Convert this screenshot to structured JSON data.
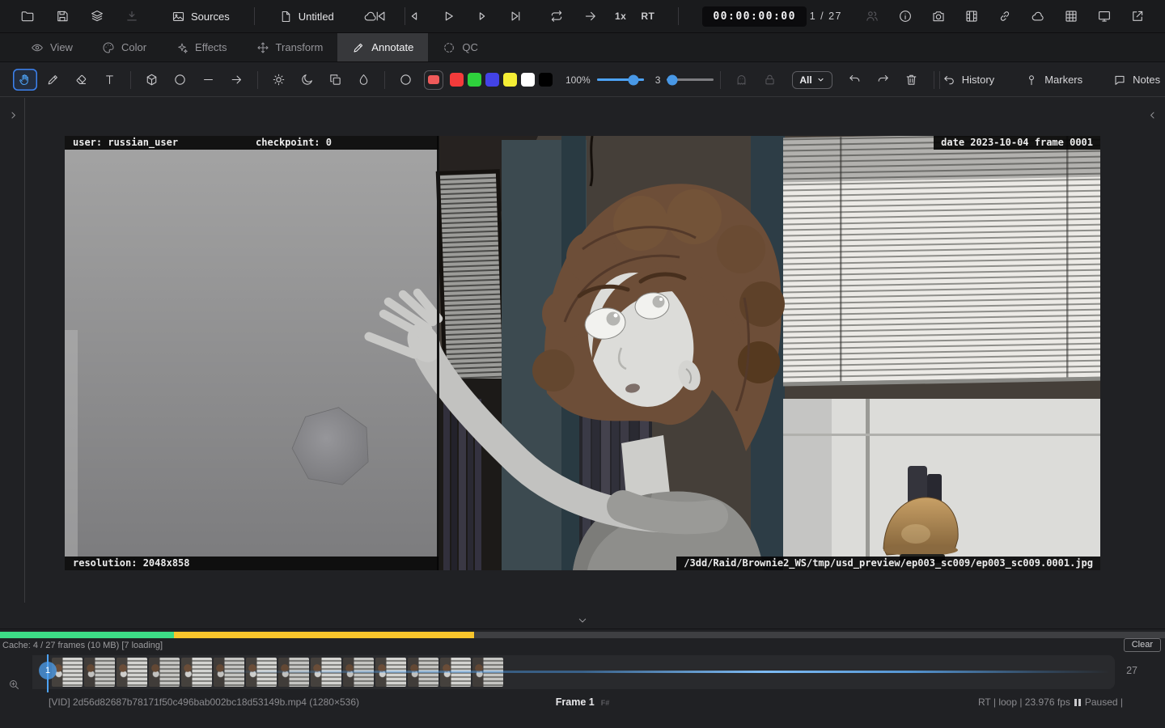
{
  "topbar": {
    "file_icons": [
      {
        "icon": "folder"
      },
      {
        "icon": "save"
      },
      {
        "icon": "layers"
      },
      {
        "icon": "download",
        "dim": true
      }
    ],
    "sources_icon": "image",
    "sources_label": "Sources",
    "untitled_icon": "file",
    "untitled_label": "Untitled",
    "cloud_icon": "cloud",
    "transport_icons": [
      {
        "icon": "skip-start"
      },
      {
        "icon": "step-back"
      },
      {
        "icon": "play"
      },
      {
        "icon": "step-forward"
      },
      {
        "icon": "skip-end"
      }
    ],
    "loop_icon": "repeat",
    "goto_icon": "arrow-right",
    "speed_label": "1x",
    "rt_label": "RT",
    "timecode": "00:00:00:00",
    "frame_counter": "1 / 27",
    "right_icons": [
      {
        "icon": "people",
        "dim": true
      },
      {
        "icon": "info"
      },
      {
        "icon": "camera"
      },
      {
        "icon": "film"
      },
      {
        "icon": "link"
      },
      {
        "icon": "cloud"
      },
      {
        "icon": "grid"
      },
      {
        "icon": "monitor"
      },
      {
        "icon": "external"
      }
    ]
  },
  "tabs": [
    {
      "label": "View",
      "icon": "eye",
      "active": false
    },
    {
      "label": "Color",
      "icon": "palette",
      "active": false
    },
    {
      "label": "Effects",
      "icon": "sparkles",
      "active": false
    },
    {
      "label": "Transform",
      "icon": "move",
      "active": false
    },
    {
      "label": "Annotate",
      "icon": "pencil",
      "active": true
    },
    {
      "label": "QC",
      "icon": "qc",
      "active": false
    }
  ],
  "annotate": {
    "tools": [
      "hand",
      "pencil",
      "eraser",
      "text",
      "|",
      "cube",
      "circle",
      "line",
      "arrow-right",
      "|",
      "sun",
      "moon",
      "copy",
      "droplet",
      "|",
      "color-ring"
    ],
    "selected_tool": "hand",
    "current_color": "#f05a5a",
    "palette": [
      "#f43b3b",
      "#2ed13c",
      "#4343e6",
      "#f5ee35",
      "#ffffff",
      "#000000"
    ],
    "opacity_label": "100%",
    "size_label": "3",
    "dim_tools": [
      "ghost",
      "lock"
    ],
    "filter_value": "All",
    "edit_icons": [
      "undo",
      "redo",
      "trash"
    ],
    "history_label": "History",
    "markers_label": "Markers",
    "notes_label": "Notes",
    "accent_color": "#4da3f7"
  },
  "viewer": {
    "user_overlay": "user: russian_user",
    "checkpoint_overlay": "checkpoint: 0",
    "date_overlay": "date 2023-10-04 frame 0001",
    "resolution_overlay": "resolution: 2048x858",
    "path_overlay": "/3dd/Raid/Brownie2_WS/tmp/usd_preview/ep003_sc009/ep003_sc009.0001.jpg"
  },
  "cache": {
    "status": "Cache: 4 / 27 frames (10 MB) [7 loading]",
    "clear_label": "Clear",
    "cached_color": "#3ddc86",
    "loading_color": "#f8c52c"
  },
  "timeline": {
    "current_frame": "1",
    "total_frames": "27",
    "thumb_count": 14
  },
  "status": {
    "media_info": "[VID] 2d56d82687b78171f50c496bab002bc18d53149b.mp4 (1280×536)",
    "frame_label": "Frame 1",
    "frame_format": "F#",
    "playback_info": "RT | loop | 23.976 fps",
    "paused_label": "Paused |"
  }
}
